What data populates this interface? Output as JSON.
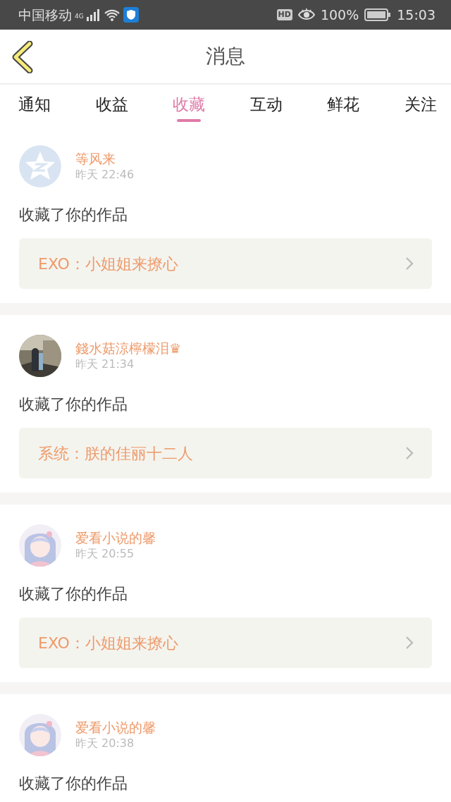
{
  "status_bar": {
    "carrier": "中国移动",
    "network": "4G",
    "hd": "HD",
    "battery_text": "100%",
    "time": "15:03"
  },
  "header": {
    "title": "消息"
  },
  "tabs": [
    {
      "label": "通知",
      "selected": false
    },
    {
      "label": "收益",
      "selected": false
    },
    {
      "label": "收藏",
      "selected": true
    },
    {
      "label": "互动",
      "selected": false
    },
    {
      "label": "鲜花",
      "selected": false
    },
    {
      "label": "关注",
      "selected": false
    }
  ],
  "messages": [
    {
      "avatar": {
        "kind": "default"
      },
      "name": "等风来",
      "time": "昨天 22:46",
      "text": "收藏了你的作品",
      "work": {
        "title": "EXO：小姐姐来撩心"
      }
    },
    {
      "name": "錢水菇涼檸檬泪♛",
      "time": "昨天 21:34",
      "text": "收藏了你的作品",
      "work": {
        "title": "系统：朕的佳丽十二人"
      }
    },
    {
      "avatar": {
        "kind": "illustration"
      },
      "name": "爱看小说的馨",
      "time": "昨天 20:55",
      "text": "收藏了你的作品",
      "work": {
        "title": "EXO：小姐姐来撩心"
      }
    },
    {
      "avatar": {
        "kind": "illustration"
      },
      "name": "爱看小说的馨",
      "time": "昨天 20:38",
      "text": "收藏了你的作品"
    }
  ]
}
